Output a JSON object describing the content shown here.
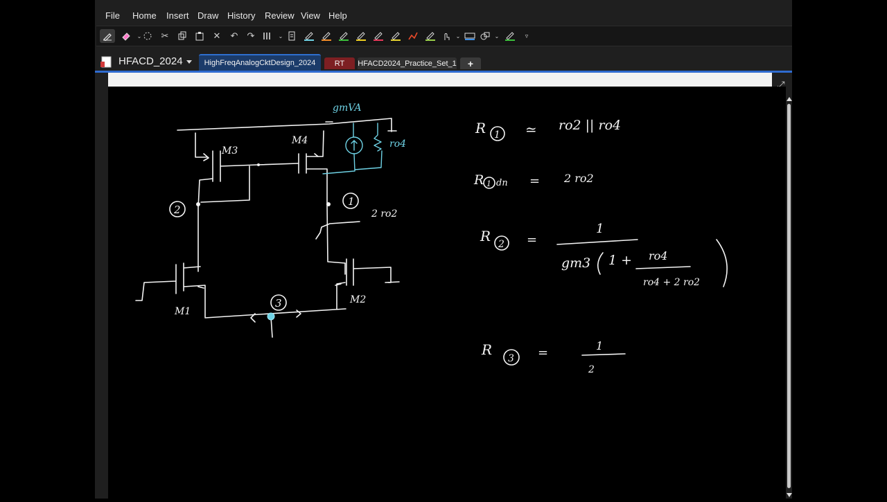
{
  "menu": [
    "File",
    "Home",
    "Insert",
    "Draw",
    "History",
    "Review",
    "View",
    "Help"
  ],
  "notebook": {
    "title": "HFACD_2024"
  },
  "tabs": [
    {
      "label": "HighFreqAnalogCktDesign_2024",
      "color": "#1b3b6a"
    },
    {
      "label": "RT",
      "color": "#7d1f22"
    },
    {
      "label": "HFACD2024_Practice_Set_1",
      "color": "#303030"
    }
  ],
  "add_tab_label": "+",
  "toolbar_icons": [
    "pen-tool-icon",
    "eraser-icon",
    "lasso-select-icon",
    "cut-icon",
    "copy-icon",
    "paste-icon",
    "delete-icon",
    "undo-icon",
    "redo-icon",
    "shapes-icon",
    "page-icon",
    "pen-cyan-icon",
    "pen-orange-icon",
    "pen-green-icon",
    "pen-yellow-icon",
    "pen-red-icon",
    "highlighter-yellow-icon",
    "pen-red-2-icon",
    "pen-green-2-icon",
    "touch-draw-icon",
    "ruler-icon",
    "shape-recognizer-icon",
    "marker-green-icon",
    "more-icon"
  ],
  "accent": "#2f6bd0",
  "ink_colors": {
    "white": "#f4f4f4",
    "cyan": "#6fd3e6"
  },
  "notes": {
    "gm_label": "gmVA",
    "m3": "M3",
    "m4": "M4",
    "m1": "M1",
    "m2": "M2",
    "ro4_label": "ro4",
    "node1": "1",
    "node2": "2",
    "node3": "3",
    "two_ro2": "2 ro2",
    "eq1_r": "R",
    "eq1_node": "1",
    "eq1_approx": "≃",
    "eq1_rhs": "ro2 || ro4",
    "eq2_r": "R",
    "eq2_node": "1",
    "eq2_sub": "dn",
    "eq2_eq": "=",
    "eq2_rhs": "2 ro2",
    "eq3_r": "R",
    "eq3_node": "2",
    "eq3_eq": "=",
    "eq3_num": "1",
    "eq3_den_a": "gm3",
    "eq3_den_b": "1 +",
    "eq3_frac_num": "ro4",
    "eq3_frac_den": "ro4 + 2 ro2",
    "eq4_r": "R",
    "eq4_node": "3",
    "eq4_eq": "=",
    "eq4_num": "1",
    "eq4_den": "2"
  }
}
